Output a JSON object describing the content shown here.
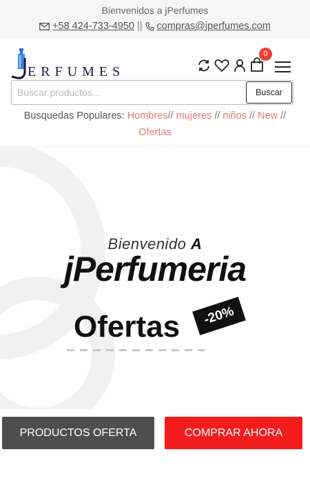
{
  "topbar": {
    "welcome": "Bienvenidos a jPerfumes",
    "phone": "+58 424-733-4950",
    "separator": "||",
    "email": "compras@jperfumes.com"
  },
  "header": {
    "logo_text": "ERFUMES",
    "cart_count": "0",
    "icons": [
      "refresh-icon",
      "heart-icon",
      "user-icon",
      "cart-icon",
      "menu-icon"
    ]
  },
  "search": {
    "placeholder": "Buscar productos...",
    "button_label": "Buscar"
  },
  "popular": {
    "label": "Busquedas Populares:",
    "links": [
      "Hombres",
      "mujeres",
      "niños",
      "New",
      "Ofertas"
    ]
  },
  "hero": {
    "subtitle_prefix": "Bienvenido",
    "subtitle_suffix": "A",
    "title": "jPerfumeria",
    "ofertas": "Ofertas",
    "badge": "-20%"
  },
  "buttons": {
    "productos_oferta": "PRODUCTOS OFERTA",
    "comprar_ahora": "COMPRAR AHORA"
  },
  "colors": {
    "accent_red": "#f31c1c",
    "dark_button": "#4e4e4e",
    "link_pink": "#e07a74",
    "badge_red": "#e8413a"
  }
}
